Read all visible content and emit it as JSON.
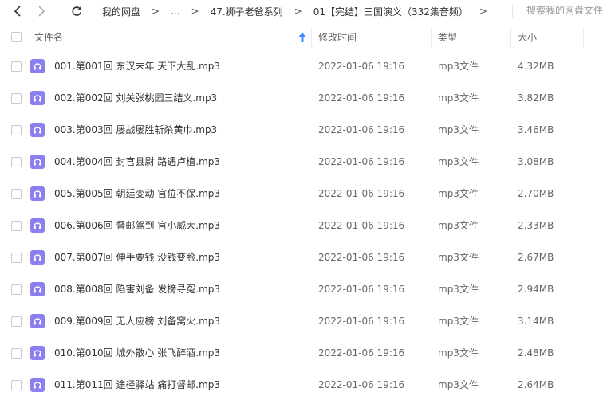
{
  "nav": {
    "back_icon": "chevron-left-icon",
    "forward_icon": "chevron-right-icon",
    "refresh_icon": "refresh-icon"
  },
  "breadcrumb": {
    "items": [
      "我的网盘",
      "...",
      "47.狮子老爸系列",
      "01【完结】三国演义（332集音频）"
    ],
    "separator": ">"
  },
  "search": {
    "placeholder": "搜索我的网盘文件"
  },
  "table": {
    "columns": {
      "name": "文件名",
      "modified": "修改时间",
      "type": "类型",
      "size": "大小"
    },
    "sort_icon": "sort-up-arrow-icon",
    "file_icon": "audio-file-icon",
    "file_icon_color": "#8a80f0",
    "sort_icon_color": "#3b8cff",
    "rows": [
      {
        "name": "001.第001回 东汉末年 天下大乱.mp3",
        "modified": "2022-01-06 19:16",
        "type": "mp3文件",
        "size": "4.32MB"
      },
      {
        "name": "002.第002回 刘关张桃园三结义.mp3",
        "modified": "2022-01-06 19:16",
        "type": "mp3文件",
        "size": "3.82MB"
      },
      {
        "name": "003.第003回 屡战屡胜斩杀黄巾.mp3",
        "modified": "2022-01-06 19:16",
        "type": "mp3文件",
        "size": "3.46MB"
      },
      {
        "name": "004.第004回 封官县尉 路遇卢植.mp3",
        "modified": "2022-01-06 19:16",
        "type": "mp3文件",
        "size": "3.08MB"
      },
      {
        "name": "005.第005回 朝廷变动 官位不保.mp3",
        "modified": "2022-01-06 19:16",
        "type": "mp3文件",
        "size": "2.70MB"
      },
      {
        "name": "006.第006回 督邮驾到 官小威大.mp3",
        "modified": "2022-01-06 19:16",
        "type": "mp3文件",
        "size": "2.33MB"
      },
      {
        "name": "007.第007回 伸手要钱 没钱变脸.mp3",
        "modified": "2022-01-06 19:16",
        "type": "mp3文件",
        "size": "2.67MB"
      },
      {
        "name": "008.第008回 陷害刘备 发榜寻冤.mp3",
        "modified": "2022-01-06 19:16",
        "type": "mp3文件",
        "size": "2.94MB"
      },
      {
        "name": "009.第009回 无人应榜 刘备窝火.mp3",
        "modified": "2022-01-06 19:16",
        "type": "mp3文件",
        "size": "3.14MB"
      },
      {
        "name": "010.第010回 城外散心 张飞醉酒.mp3",
        "modified": "2022-01-06 19:16",
        "type": "mp3文件",
        "size": "2.48MB"
      },
      {
        "name": "011.第011回 途径驿站 痛打督邮.mp3",
        "modified": "2022-01-06 19:16",
        "type": "mp3文件",
        "size": "2.64MB"
      }
    ]
  }
}
